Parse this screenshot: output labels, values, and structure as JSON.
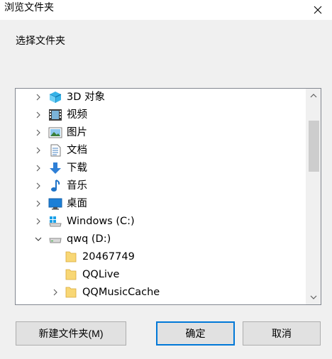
{
  "window": {
    "title": "浏览文件夹",
    "close_icon": "close-icon"
  },
  "dialog": {
    "prompt": "选择文件夹"
  },
  "tree": {
    "items": [
      {
        "label": "3D 对象",
        "icon": "3d-objects-icon",
        "expander": "collapsed"
      },
      {
        "label": "视频",
        "icon": "videos-icon",
        "expander": "collapsed"
      },
      {
        "label": "图片",
        "icon": "pictures-icon",
        "expander": "collapsed"
      },
      {
        "label": "文档",
        "icon": "documents-icon",
        "expander": "collapsed"
      },
      {
        "label": "下载",
        "icon": "downloads-icon",
        "expander": "collapsed"
      },
      {
        "label": "音乐",
        "icon": "music-icon",
        "expander": "collapsed"
      },
      {
        "label": "桌面",
        "icon": "desktop-icon",
        "expander": "collapsed"
      },
      {
        "label": "Windows (C:)",
        "icon": "windows-drive-icon",
        "expander": "collapsed"
      },
      {
        "label": "qwq (D:)",
        "icon": "drive-icon",
        "expander": "expanded"
      },
      {
        "label": "20467749",
        "icon": "folder-icon",
        "expander": "none"
      },
      {
        "label": "QQLive",
        "icon": "folder-icon",
        "expander": "none"
      },
      {
        "label": "QQMusicCache",
        "icon": "folder-icon",
        "expander": "collapsed"
      }
    ]
  },
  "buttons": {
    "new_folder": "新建文件夹(M)",
    "ok": "确定",
    "cancel": "取消"
  },
  "colors": {
    "accent": "#0078d7",
    "folder": "#f8d775",
    "dialog_bg": "#f0f0f0"
  }
}
